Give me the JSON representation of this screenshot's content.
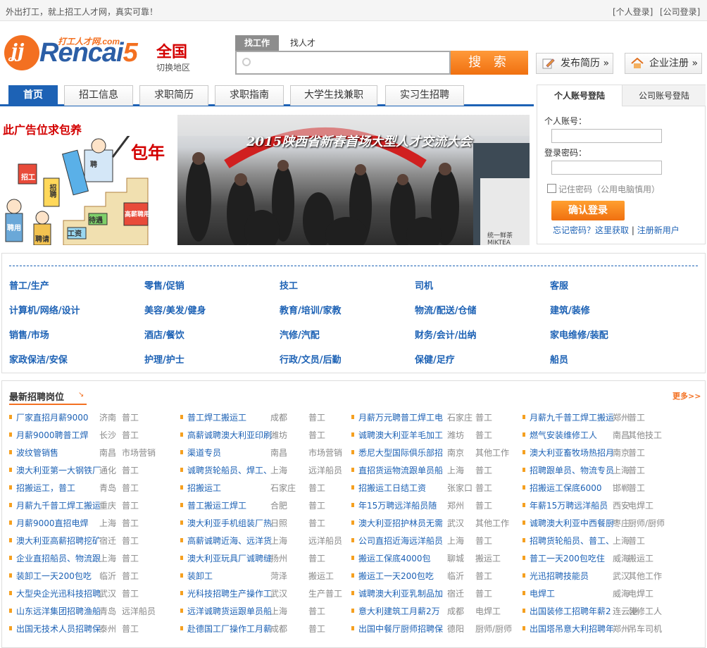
{
  "topbar": {
    "slogan": "外出打工，就上招工人才网，真实可靠！",
    "personal_login": "[个人登录]",
    "company_login": "[公司登录]"
  },
  "logo": {
    "word_blue": "Rencai",
    "word_orange": "5",
    "small_text": "打工人才网.com",
    "ring_mark": "ʝj"
  },
  "region": {
    "name": "全国",
    "switch": "切换地区"
  },
  "search": {
    "tab_find_job": "找工作",
    "tab_find_talent": "找人才",
    "input_value": "",
    "button": "搜 索"
  },
  "header_buttons": {
    "post_resume": "发布简历 »",
    "company_register": "企业注册 »"
  },
  "nav": {
    "tabs": [
      "首页",
      "招工信息",
      "求职简历",
      "求职指南",
      "大学生找兼职",
      "实习生招聘"
    ]
  },
  "banners": {
    "ad_title": "此广告位求包养",
    "ad_big": "包年",
    "ad_signs": [
      "招工",
      "招聘",
      "聘用",
      "聘请",
      "待遇",
      "工资",
      "高薪聘用",
      "聘"
    ],
    "fair_title": "2015陕西省新春首场大型人才交流大会",
    "sign_text": "统一鲜茶 MIKTEA"
  },
  "login": {
    "tab_personal": "个人账号登陆",
    "tab_company": "公司账号登陆",
    "account_label": "个人账号：",
    "password_label": "登录密码：",
    "remember": "记住密码（公用电脑慎用）",
    "submit": "确认登录",
    "forgot": "忘记密码？这里获取",
    "separator": "|",
    "register": "注册新用户"
  },
  "categories": [
    [
      "普工/生产",
      "零售/促销",
      "技工",
      "司机",
      "客服"
    ],
    [
      "计算机/网络/设计",
      "美容/美发/健身",
      "教育/培训/家教",
      "物流/配送/仓储",
      "建筑/装修"
    ],
    [
      "销售/市场",
      "酒店/餐饮",
      "汽修/汽配",
      "财务/会计/出纳",
      "家电维修/装配"
    ],
    [
      "家政保洁/安保",
      "护理/护士",
      "行政/文员/后勤",
      "保健/足疗",
      "船员"
    ]
  ],
  "jobs_section": {
    "title": "最新招聘岗位",
    "more": "更多>>"
  },
  "jobs": [
    [
      [
        "厂家直招月薪9000",
        "济南",
        "普工"
      ],
      [
        "普工焊工搬运工",
        "成都",
        "普工"
      ],
      [
        "月薪万元聘普工焊工电",
        "石家庄",
        "普工"
      ],
      [
        "月薪九千普工焊工搬运",
        "郑州",
        "普工"
      ]
    ],
    [
      [
        "月薪9000聘普工焊",
        "长沙",
        "普工"
      ],
      [
        "高薪诚聘澳大利亚印刷",
        "潍坊",
        "普工"
      ],
      [
        "诚聘澳大利亚羊毛加工",
        "潍坊",
        "普工"
      ],
      [
        "燃气安装维修工人",
        "南昌",
        "其他技工"
      ]
    ],
    [
      [
        "波纹管销售",
        "南昌",
        "市场营销"
      ],
      [
        "渠道专员",
        "南昌",
        "市场营销"
      ],
      [
        "悉尼大型国际俱乐部招",
        "南京",
        "其他工作"
      ],
      [
        "澳大利亚畜牧场热招月",
        "南京",
        "普工"
      ]
    ],
    [
      [
        "澳大利亚第一大钢铁厂",
        "通化",
        "普工"
      ],
      [
        "诚聘货轮船员、焊工、",
        "上海",
        "远洋船员"
      ],
      [
        "直招货运物流跟单员船",
        "上海",
        "普工"
      ],
      [
        "招聘跟单员、物流专员",
        "上海",
        "普工"
      ]
    ],
    [
      [
        "招搬运工，普工",
        "青岛",
        "普工"
      ],
      [
        "招搬运工",
        "石家庄",
        "普工"
      ],
      [
        "招搬运工日结工资",
        "张家口",
        "普工"
      ],
      [
        "招搬运工保底6000",
        "邯郸",
        "普工"
      ]
    ],
    [
      [
        "月薪九千普工焊工搬运",
        "重庆",
        "普工"
      ],
      [
        "普工搬运工焊工",
        "合肥",
        "普工"
      ],
      [
        "年15万聘远洋船员随",
        "郑州",
        "普工"
      ],
      [
        "年薪15万聘远洋船员",
        "西安",
        "电焊工"
      ]
    ],
    [
      [
        "月薪9000直招电焊",
        "上海",
        "普工"
      ],
      [
        "澳大利亚手机组装厂热",
        "日照",
        "普工"
      ],
      [
        "澳大利亚招护林员无需",
        "武汉",
        "其他工作"
      ],
      [
        "诚聘澳大利亚中西餐厨",
        "枣庄",
        "厨师/厨师"
      ]
    ],
    [
      [
        "澳大利亚高薪招聘挖矿",
        "宿迁",
        "普工"
      ],
      [
        "高薪诚聘近海、远洋货",
        "上海",
        "远洋船员"
      ],
      [
        "公司直招近海远洋船员",
        "上海",
        "普工"
      ],
      [
        "招聘货轮船员、普工、",
        "上海",
        "普工"
      ]
    ],
    [
      [
        "企业直招船员、物流跟",
        "上海",
        "普工"
      ],
      [
        "澳大利亚玩具厂诚聘缝",
        "扬州",
        "普工"
      ],
      [
        "搬运工保底4000包",
        "聊城",
        "搬运工"
      ],
      [
        "普工一天200包吃住",
        "威海",
        "搬运工"
      ]
    ],
    [
      [
        "装卸工一天200包吃",
        "临沂",
        "普工"
      ],
      [
        "装卸工",
        "菏泽",
        "搬运工"
      ],
      [
        "搬运工一天200包吃",
        "临沂",
        "普工"
      ],
      [
        "光迅招聘技能员",
        "武汉",
        "其他工作"
      ]
    ],
    [
      [
        "大型央企光迅科技招聘",
        "武汉",
        "普工"
      ],
      [
        "光科技招聘生产操作工",
        "武汉",
        "生产普工"
      ],
      [
        "诚聘澳大利亚乳制品加",
        "宿迁",
        "普工"
      ],
      [
        "电焊工",
        "威海",
        "电焊工"
      ]
    ],
    [
      [
        "山东远洋集团招聘渔船",
        "青岛",
        "远洋船员"
      ],
      [
        "远洋诚聘货运跟单员船",
        "上海",
        "普工"
      ],
      [
        "意大利建筑工月薪2万",
        "成都",
        "电焊工"
      ],
      [
        "出国装修工招聘年薪2",
        "连云港",
        "装修工人"
      ]
    ],
    [
      [
        "出国无技术人员招聘保",
        "泰州",
        "普工"
      ],
      [
        "赴德国工厂操作工月薪",
        "成都",
        "普工"
      ],
      [
        "出国中餐厅厨师招聘保",
        "德阳",
        "厨师/厨师"
      ],
      [
        "出国塔吊意大利招聘年",
        "郑州",
        "吊车司机"
      ]
    ]
  ],
  "colors": {
    "brand_blue": "#1d62b5",
    "brand_orange": "#f37021",
    "link_blue": "#1d62b5"
  }
}
